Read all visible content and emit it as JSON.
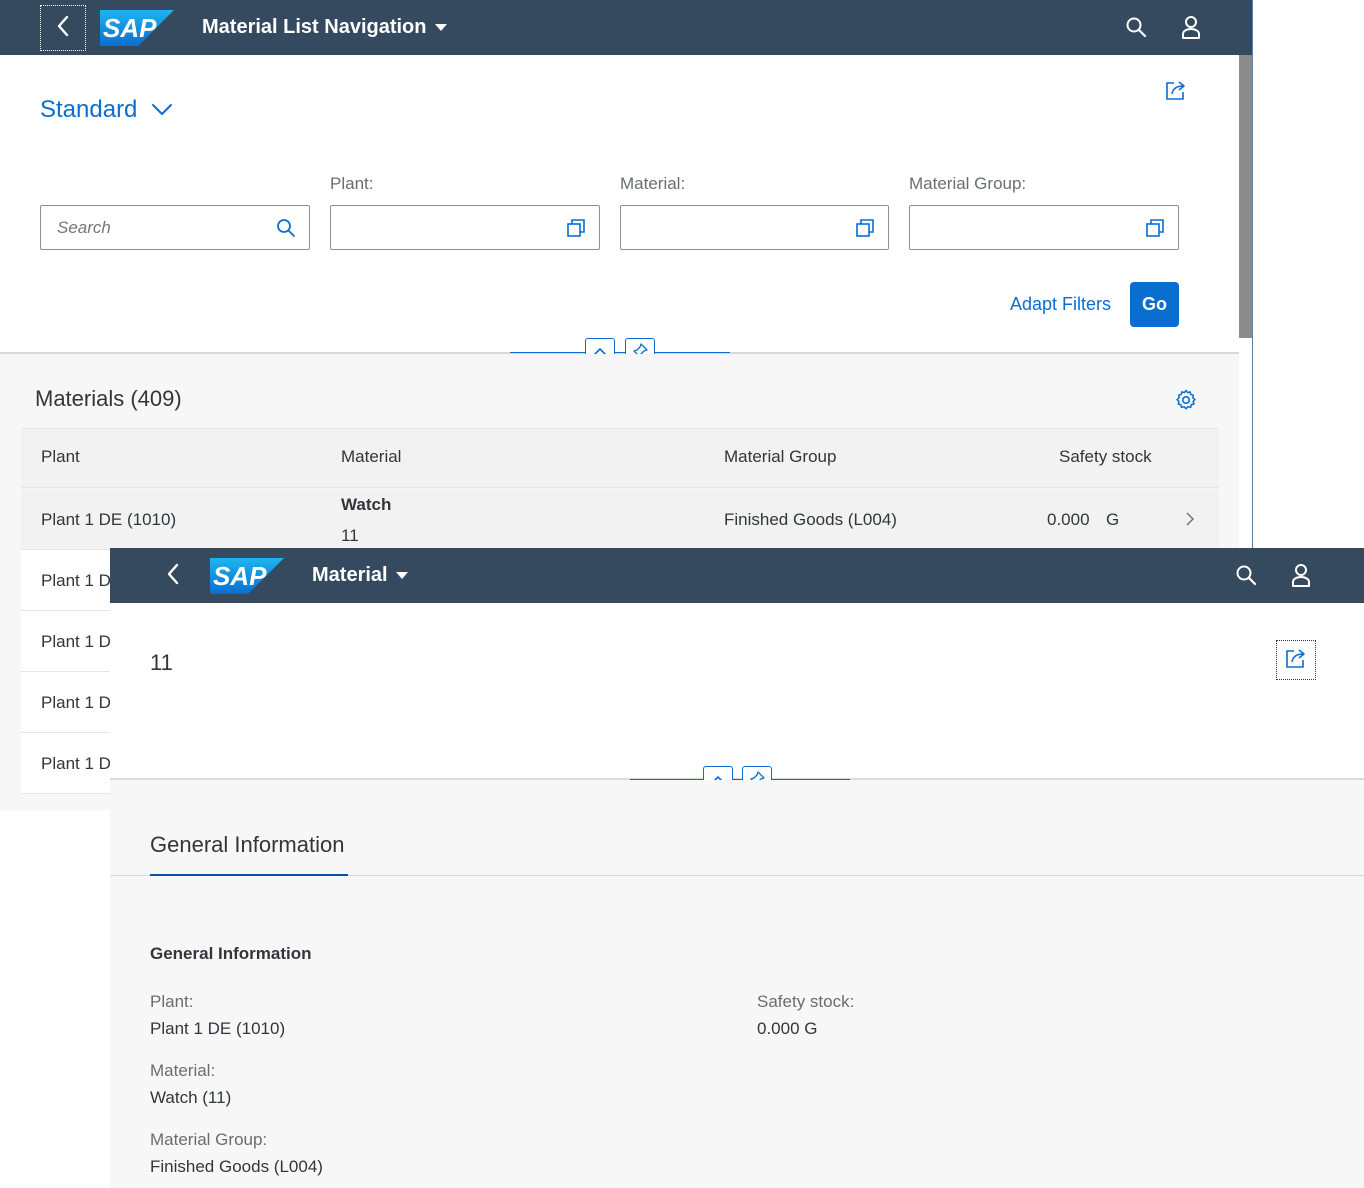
{
  "window1": {
    "app_title": "Material List Navigation",
    "variant_name": "Standard",
    "search_placeholder": "Search",
    "filters": [
      {
        "label": "Plant:",
        "value": ""
      },
      {
        "label": "Material:",
        "value": ""
      },
      {
        "label": "Material Group:",
        "value": ""
      }
    ],
    "adapt_filters_label": "Adapt Filters",
    "go_label": "Go",
    "table_title": "Materials (409)",
    "columns": [
      "Plant",
      "Material",
      "Material Group",
      "Safety stock"
    ],
    "rows": [
      {
        "plant": "Plant 1 DE (1010)",
        "material_name": "Watch",
        "material_id": "11",
        "material_group": "Finished Goods (L004)",
        "safety_stock": "0.000",
        "unit": "G"
      },
      {
        "plant": "Plant 1 D"
      },
      {
        "plant": "Plant 1 D"
      },
      {
        "plant": "Plant 1 D"
      },
      {
        "plant": "Plant 1 D"
      }
    ]
  },
  "window2": {
    "app_title": "Material",
    "object_title": "11",
    "anchor_tab": "General Information",
    "section_title": "General Information",
    "fields": {
      "plant": {
        "label": "Plant:",
        "value": "Plant 1 DE (1010)"
      },
      "material": {
        "label": "Material:",
        "value": "Watch (11)"
      },
      "material_group": {
        "label": "Material Group:",
        "value": "Finished Goods (L004)"
      },
      "safety_stock": {
        "label": "Safety stock:",
        "value": "0.000 G"
      }
    }
  },
  "logo_text": "SAP",
  "icons": {
    "back": "chevron-left-icon",
    "search": "search-icon",
    "user": "user-icon",
    "share": "share-icon",
    "value_help": "value-help-icon",
    "collapse": "chevron-up-icon",
    "pin": "pin-icon",
    "settings": "gear-icon",
    "nav": "chevron-right-icon"
  },
  "colors": {
    "shell": "#354a5f",
    "accent": "#0a6ed1",
    "text": "#32363a",
    "label": "#6a6d70",
    "background": "#f7f7f7"
  }
}
